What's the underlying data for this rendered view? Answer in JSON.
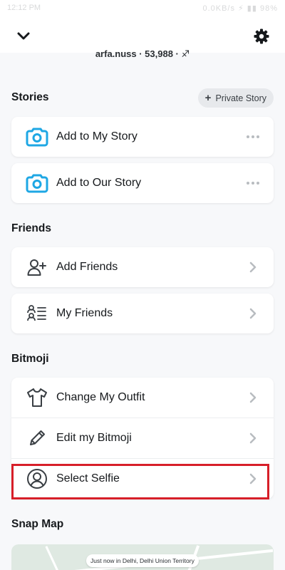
{
  "status_bar": {
    "time": "12:12 PM",
    "right": "0.0KB/s ⚡ ▮▮ 98%"
  },
  "header": {
    "subtitle": "arfa.nuss · 53,988 · ♐",
    "back_icon": "chevron-down-icon",
    "settings_icon": "gear-icon"
  },
  "stories": {
    "title": "Stories",
    "private_story_button": "Private Story",
    "items": [
      {
        "label": "Add to My Story",
        "icon": "camera-icon"
      },
      {
        "label": "Add to Our Story",
        "icon": "camera-icon"
      }
    ]
  },
  "friends": {
    "title": "Friends",
    "items": [
      {
        "label": "Add Friends",
        "icon": "add-friend-icon"
      },
      {
        "label": "My Friends",
        "icon": "friends-list-icon"
      }
    ]
  },
  "bitmoji": {
    "title": "Bitmoji",
    "items": [
      {
        "label": "Change My Outfit",
        "icon": "shirt-icon"
      },
      {
        "label": "Edit my Bitmoji",
        "icon": "pencil-icon"
      },
      {
        "label": "Select Selfie",
        "icon": "selfie-icon"
      }
    ]
  },
  "snap_map": {
    "title": "Snap Map",
    "location_tip": "Just now in Delhi, Delhi Union Territory"
  },
  "colors": {
    "camera_blue": "#1ea7e4",
    "highlight_red": "#d71f29",
    "background": "#f7f8fa"
  }
}
